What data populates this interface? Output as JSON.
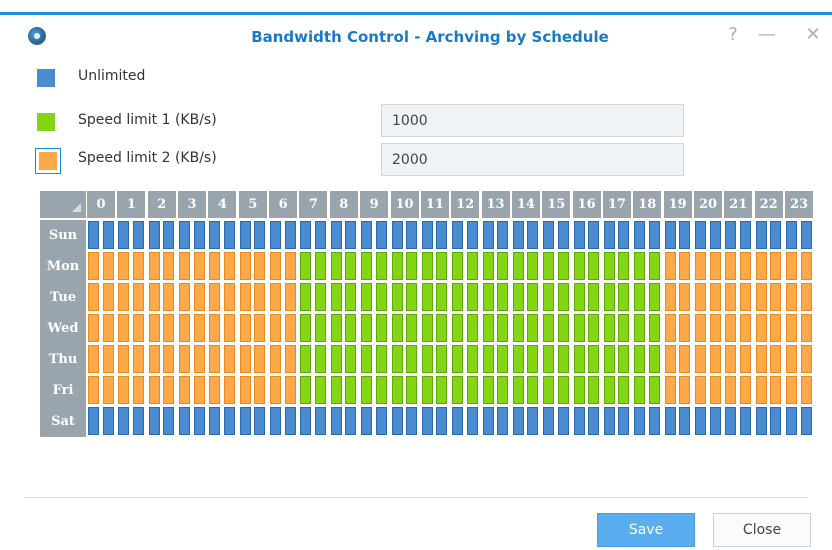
{
  "dialog": {
    "title": "Bandwidth Control - Archving by Schedule",
    "help_label": "?",
    "minimize_label": "—",
    "close_label": "✕"
  },
  "legend": {
    "unlimited": {
      "label": "Unlimited",
      "color": "#4a8ccf"
    },
    "speed1": {
      "label": "Speed limit 1 (KB/s)",
      "color": "#84d614",
      "value": "1000"
    },
    "speed2": {
      "label": "Speed limit 2 (KB/s)",
      "color": "#fda94a",
      "value": "2000",
      "selected": true
    }
  },
  "schedule": {
    "hours": [
      "0",
      "1",
      "2",
      "3",
      "4",
      "5",
      "6",
      "7",
      "8",
      "9",
      "10",
      "11",
      "12",
      "13",
      "14",
      "15",
      "16",
      "17",
      "18",
      "19",
      "20",
      "21",
      "22",
      "23"
    ],
    "days": [
      {
        "label": "Sun",
        "weekday": false
      },
      {
        "label": "Mon",
        "weekday": true
      },
      {
        "label": "Tue",
        "weekday": true
      },
      {
        "label": "Wed",
        "weekday": true
      },
      {
        "label": "Thu",
        "weekday": true
      },
      {
        "label": "Fri",
        "weekday": true
      },
      {
        "label": "Sat",
        "weekday": false
      }
    ],
    "weekday_speed_limit_1_hours": [
      7,
      18
    ],
    "color_legend": {
      "0": "Unlimited",
      "1": "Speed limit 1",
      "2": "Speed limit 2"
    }
  },
  "footer": {
    "save_label": "Save",
    "close_label": "Close"
  }
}
